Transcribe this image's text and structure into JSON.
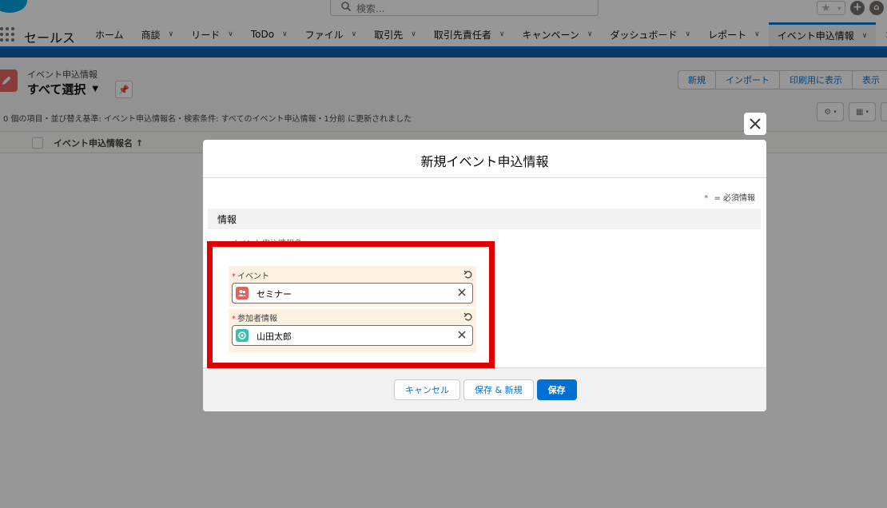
{
  "search": {
    "placeholder": "検索..."
  },
  "nav": {
    "app_name": "セールス",
    "items": [
      {
        "label": "ホーム",
        "has_menu": false
      },
      {
        "label": "商談",
        "has_menu": true
      },
      {
        "label": "リード",
        "has_menu": true
      },
      {
        "label": "ToDo",
        "has_menu": true
      },
      {
        "label": "ファイル",
        "has_menu": true
      },
      {
        "label": "取引先",
        "has_menu": true
      },
      {
        "label": "取引先責任者",
        "has_menu": true
      },
      {
        "label": "キャンペーン",
        "has_menu": true
      },
      {
        "label": "ダッシュボード",
        "has_menu": true
      },
      {
        "label": "レポート",
        "has_menu": true
      },
      {
        "label": "イベント申込情報",
        "has_menu": true,
        "active": true
      },
      {
        "label": "さら",
        "has_menu": false
      }
    ]
  },
  "list_header": {
    "object_label": "イベント申込情報",
    "view_name": "すべて選択",
    "buttons": [
      "新規",
      "インポート",
      "印刷用に表示",
      "表示"
    ],
    "meta": "0 個の項目・並び替え基準: イベント申込情報名・検索条件: すべてのイベント申込情報・1分前 に更新されました",
    "column_header": "イベント申込情報名 ↑"
  },
  "modal": {
    "title": "新規イベント申込情報",
    "required_note_star": "*",
    "required_note": "= 必須情報",
    "section_title": "情報",
    "faded_label": "イベント申込情報名",
    "fields": [
      {
        "label": "イベント",
        "value": "セミナー",
        "icon_color": "#e6615c"
      },
      {
        "label": "参加者情報",
        "value": "山田太郎",
        "icon_color": "#3ebdae"
      }
    ],
    "buttons": {
      "cancel": "キャンセル",
      "save_new": "保存 & 新規",
      "save": "保存"
    }
  },
  "colors": {
    "brand_blue": "#0070d2",
    "highlight_red": "#e00000",
    "edited_field_bg": "#fdf1e2"
  }
}
